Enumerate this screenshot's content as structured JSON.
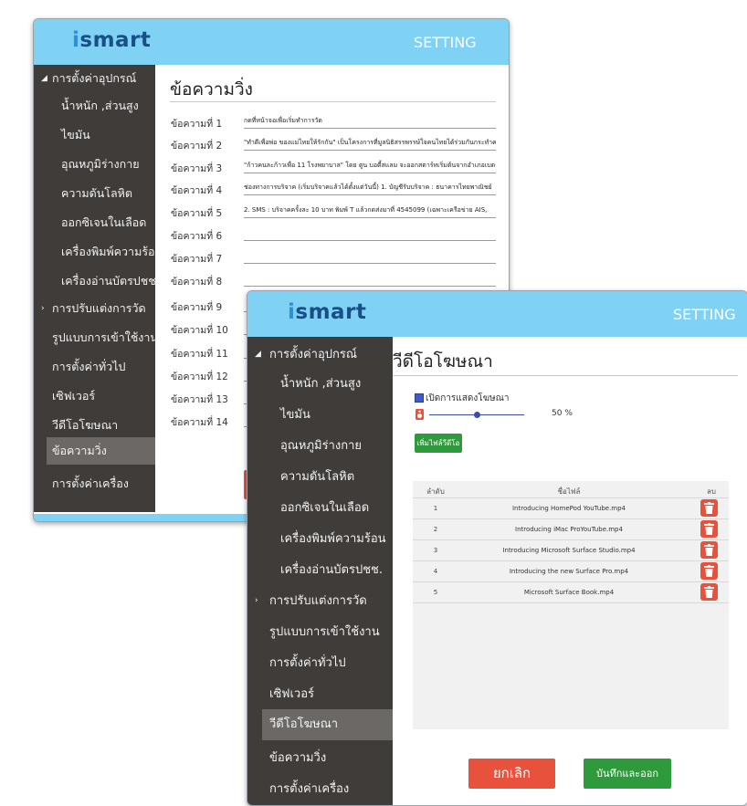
{
  "colors": {
    "header": "#7fd2f4",
    "sidebar": "#3f3c3a",
    "sidebar_active": "#6b6866",
    "logo": "#174f86",
    "danger": "#e8523c",
    "success": "#2e9a3c"
  },
  "back_window": {
    "logo": "smart",
    "header_right": "SETTING",
    "nav": [
      {
        "label": "การตั้งค่าอุปกรณ์"
      },
      {
        "label": "น้ำหนัก ,ส่วนสูง"
      },
      {
        "label": "ไขมัน"
      },
      {
        "label": "อุณหภูมิร่างกาย"
      },
      {
        "label": "ความดันโลหิต"
      },
      {
        "label": "ออกซิเจนในเลือด"
      },
      {
        "label": "เครื่องพิมพ์ความร้อน"
      },
      {
        "label": "เครื่องอ่านบัตรปชช."
      },
      {
        "label": "การปรับแต่งการวัด"
      },
      {
        "label": "รูปแบบการเข้าใช้งาน"
      },
      {
        "label": "การตั้งค่าทั่วไป"
      },
      {
        "label": "เซิฟเวอร์"
      },
      {
        "label": "วีดีโอโฆษณา"
      },
      {
        "label": "ข้อความวิ่ง"
      },
      {
        "label": "การตั้งค่าเครื่อง"
      }
    ],
    "page_title": "ข้อความวิ่ง",
    "messages": [
      {
        "label": "ข้อความที่ 1",
        "value": "กดที่หน้าจอเพื่อเริ่มทำการวัด"
      },
      {
        "label": "ข้อความที่ 2",
        "value": "\"ทำดีเพื่อพ่อ ของแม่ไทยให้รักกัน\" เป็นโครงการที่มูลนิธิสรรพรรษ์ใจคนไทยได้ร่วมกันกระทำความ"
      },
      {
        "label": "ข้อความที่ 3",
        "value": "\"ก้าวคนละก้าวเพื่อ 11 โรงพยาบาล\" โดย ตูน บอดี้สแลม จะออกสตาร์ทเริ่มต้นจากอำเภอเบตง"
      },
      {
        "label": "ข้อความที่ 4",
        "value": "ช่องทางการบริจาค (เริ่มบริจาคแล้วได้ตั้งแต่วันนี้) 1. บัญชีรับบริจาค : ธนาคารไทยพาณิชย์"
      },
      {
        "label": "ข้อความที่ 5",
        "value": "2. SMS : บริจาคครั้งละ 10 บาท พิมพ์ T แล้วกดส่งมาที่ 4545099 (เฉพาะเครือข่าย AIS,"
      },
      {
        "label": "ข้อความที่ 6",
        "value": ""
      },
      {
        "label": "ข้อความที่ 7",
        "value": ""
      },
      {
        "label": "ข้อความที่ 8",
        "value": ""
      },
      {
        "label": "ข้อความที่ 9",
        "value": ""
      },
      {
        "label": "ข้อความที่ 10",
        "value": ""
      },
      {
        "label": "ข้อความที่ 11",
        "value": ""
      },
      {
        "label": "ข้อความที่ 12",
        "value": ""
      },
      {
        "label": "ข้อความที่ 13",
        "value": ""
      },
      {
        "label": "ข้อความที่ 14",
        "value": ""
      }
    ]
  },
  "front_window": {
    "logo": "smart",
    "header_right": "SETTING",
    "nav": [
      {
        "label": "การตั้งค่าอุปกรณ์"
      },
      {
        "label": "น้ำหนัก ,ส่วนสูง"
      },
      {
        "label": "ไขมัน"
      },
      {
        "label": "อุณหภูมิร่างกาย"
      },
      {
        "label": "ความดันโลหิต"
      },
      {
        "label": "ออกซิเจนในเลือด"
      },
      {
        "label": "เครื่องพิมพ์ความร้อน"
      },
      {
        "label": "เครื่องอ่านบัตรปชช."
      },
      {
        "label": "การปรับแต่งการวัด"
      },
      {
        "label": "รูปแบบการเข้าใช้งาน"
      },
      {
        "label": "การตั้งค่าทั่วไป"
      },
      {
        "label": "เซิฟเวอร์"
      },
      {
        "label": "วีดีโอโฆษณา"
      },
      {
        "label": "ข้อความวิ่ง"
      },
      {
        "label": "การตั้งค่าเครื่อง"
      }
    ],
    "page_title": "วีดีโอโฆษณา",
    "show_ads_label": "เปิดการแสดงโฆษณา",
    "show_ads_checked": true,
    "volume_text": "50 %",
    "volume_fraction": 0.5,
    "add_video_label": "เพิ่มไฟล์วีดีโอ",
    "table": {
      "headers": [
        "ลำดับ",
        "ชื่อไฟล์",
        "ลบ"
      ],
      "rows": [
        {
          "no": "1",
          "file": "Introducing HomePod YouTube.mp4"
        },
        {
          "no": "2",
          "file": "Introducing iMac ProYouTube.mp4"
        },
        {
          "no": "3",
          "file": "Introducing Microsoft Surface Studio.mp4"
        },
        {
          "no": "4",
          "file": "Introducing the new Surface Pro.mp4"
        },
        {
          "no": "5",
          "file": "Microsoft Surface Book.mp4"
        }
      ]
    },
    "cancel_label": "ยกเลิก",
    "save_label": "บันทึกและออก"
  }
}
